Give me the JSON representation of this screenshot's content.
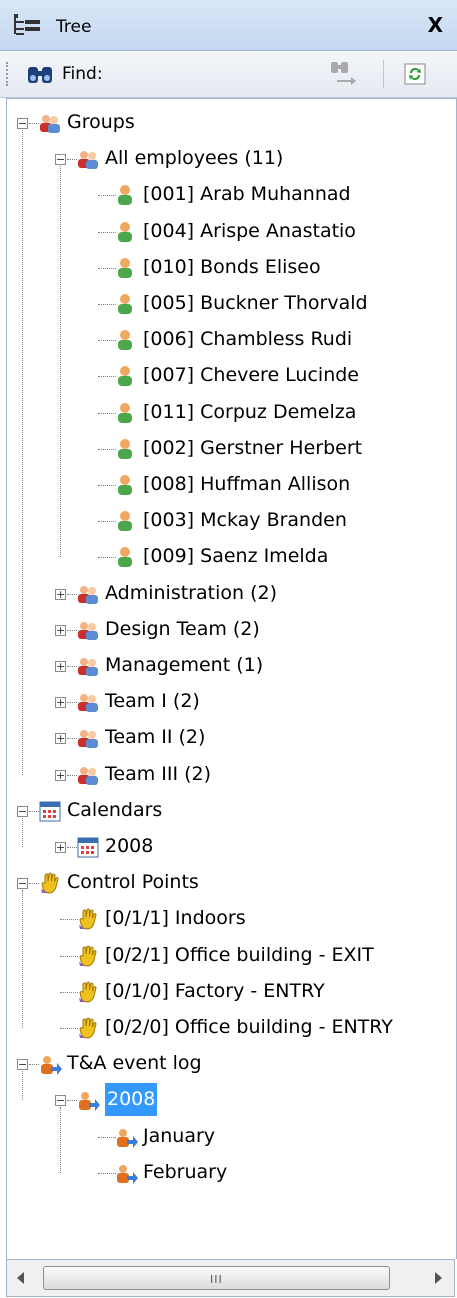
{
  "panel": {
    "title": "Tree",
    "close_label": "X"
  },
  "toolbar": {
    "find_label": "Find:"
  },
  "tree": {
    "groups": "Groups",
    "all_employees": "All employees (11)",
    "employees": [
      "[001]  Arab Muhannad",
      "[004]  Arispe Anastatio",
      "[010]  Bonds Eliseo",
      "[005]  Buckner Thorvald",
      "[006]  Chambless Rudi",
      "[007]  Chevere Lucinde",
      "[011]  Corpuz Demelza",
      "[002]  Gerstner Herbert",
      "[008]  Huffman Allison",
      "[003]  Mckay Branden",
      "[009]  Saenz Imelda"
    ],
    "groups_list": [
      "Administration (2)",
      "Design Team (2)",
      "Management (1)",
      "Team I (2)",
      "Team II (2)",
      "Team III (2)"
    ],
    "calendars": "Calendars",
    "calendar_year": "2008",
    "control_points": "Control Points",
    "control_points_list": [
      "[0/1/1] Indoors",
      "[0/2/1] Office building - EXIT",
      "[0/1/0] Factory - ENTRY",
      "[0/2/0] Office building - ENTRY"
    ],
    "event_log": "T&A event log",
    "event_year": "2008",
    "months": [
      "January",
      "February"
    ]
  },
  "scrollbar": {
    "grip": "III"
  },
  "colors": {
    "selection": "#3399ff",
    "titlebar": "#c5d8f1"
  }
}
